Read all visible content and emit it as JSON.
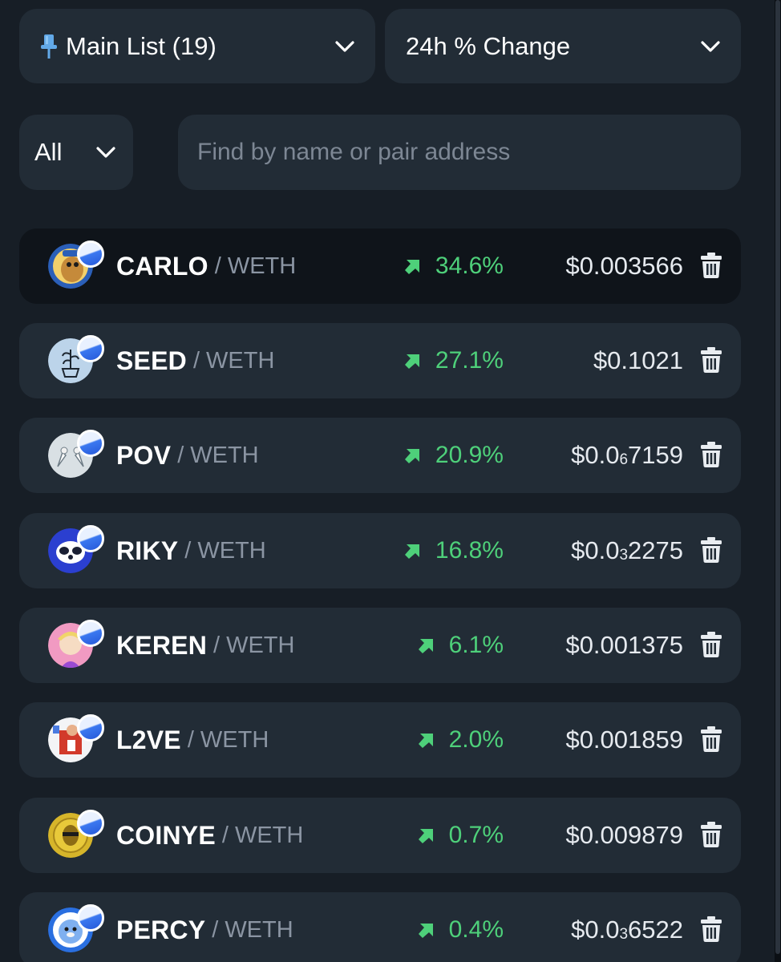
{
  "header": {
    "list_dropdown": {
      "label": "Main List (19)",
      "icon": "pin-icon"
    },
    "sort_dropdown": {
      "label": "24h % Change"
    },
    "filter_dropdown": {
      "label": "All"
    },
    "search": {
      "placeholder": "Find by name or pair address",
      "value": ""
    }
  },
  "colors": {
    "background": "#171e26",
    "card": "#222c36",
    "card_active": "#0f141a",
    "positive": "#4ed07a",
    "muted": "#8b95a3"
  },
  "tokens": [
    {
      "symbol": "CARLO",
      "quote": "WETH",
      "change": "34.6%",
      "price_prefix": "$0.003566",
      "price_sub": "",
      "price_suffix": "",
      "active": true
    },
    {
      "symbol": "SEED",
      "quote": "WETH",
      "change": "27.1%",
      "price_prefix": "$0.1021",
      "price_sub": "",
      "price_suffix": "",
      "active": false
    },
    {
      "symbol": "POV",
      "quote": "WETH",
      "change": "20.9%",
      "price_prefix": "$0.0",
      "price_sub": "6",
      "price_suffix": "7159",
      "active": false
    },
    {
      "symbol": "RIKY",
      "quote": "WETH",
      "change": "16.8%",
      "price_prefix": "$0.0",
      "price_sub": "3",
      "price_suffix": "2275",
      "active": false
    },
    {
      "symbol": "KEREN",
      "quote": "WETH",
      "change": "6.1%",
      "price_prefix": "$0.001375",
      "price_sub": "",
      "price_suffix": "",
      "active": false
    },
    {
      "symbol": "L2VE",
      "quote": "WETH",
      "change": "2.0%",
      "price_prefix": "$0.001859",
      "price_sub": "",
      "price_suffix": "",
      "active": false
    },
    {
      "symbol": "COINYE",
      "quote": "WETH",
      "change": "0.7%",
      "price_prefix": "$0.009879",
      "price_sub": "",
      "price_suffix": "",
      "active": false
    },
    {
      "symbol": "PERCY",
      "quote": "WETH",
      "change": "0.4%",
      "price_prefix": "$0.0",
      "price_sub": "3",
      "price_suffix": "6522",
      "active": false
    }
  ]
}
